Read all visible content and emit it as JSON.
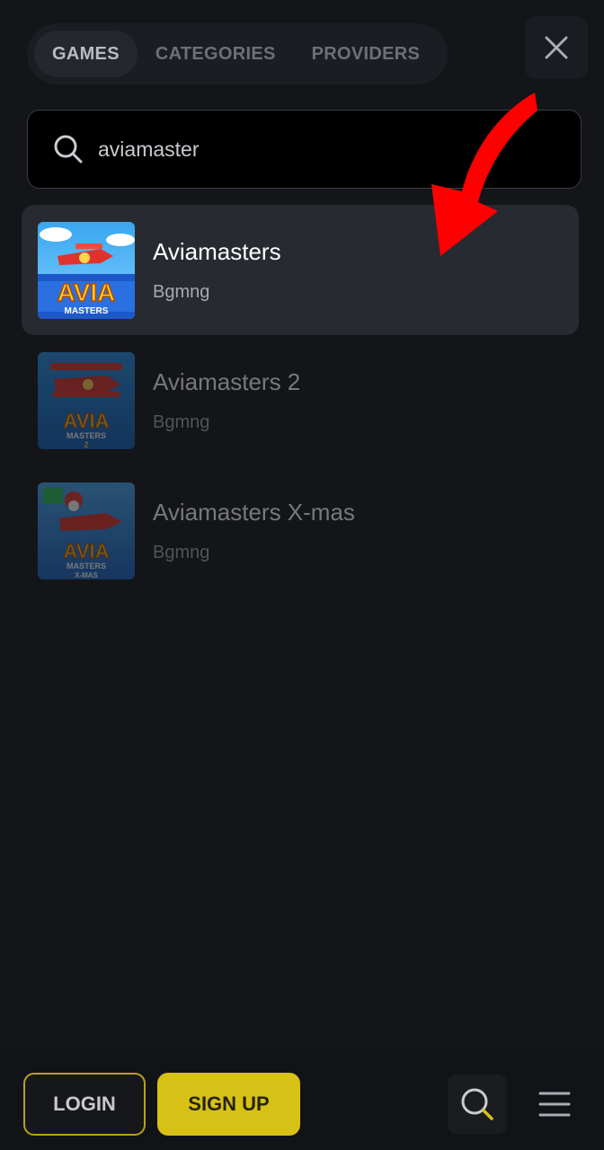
{
  "tabs": [
    {
      "label": "GAMES",
      "active": true
    },
    {
      "label": "CATEGORIES",
      "active": false
    },
    {
      "label": "PROVIDERS",
      "active": false
    }
  ],
  "search": {
    "value": "aviamaster",
    "icon": "search-icon"
  },
  "results": [
    {
      "title": "Aviamasters",
      "provider": "Bgmng",
      "highlighted": true
    },
    {
      "title": "Aviamasters 2",
      "provider": "Bgmng",
      "highlighted": false
    },
    {
      "title": "Aviamasters X-mas",
      "provider": "Bgmng",
      "highlighted": false
    }
  ],
  "bottom_bar": {
    "login_label": "LOGIN",
    "signup_label": "SIGN UP"
  },
  "colors": {
    "accent": "#d8c117",
    "background": "#131519",
    "highlight_row": "#272a31",
    "arrow": "#ff0000"
  }
}
